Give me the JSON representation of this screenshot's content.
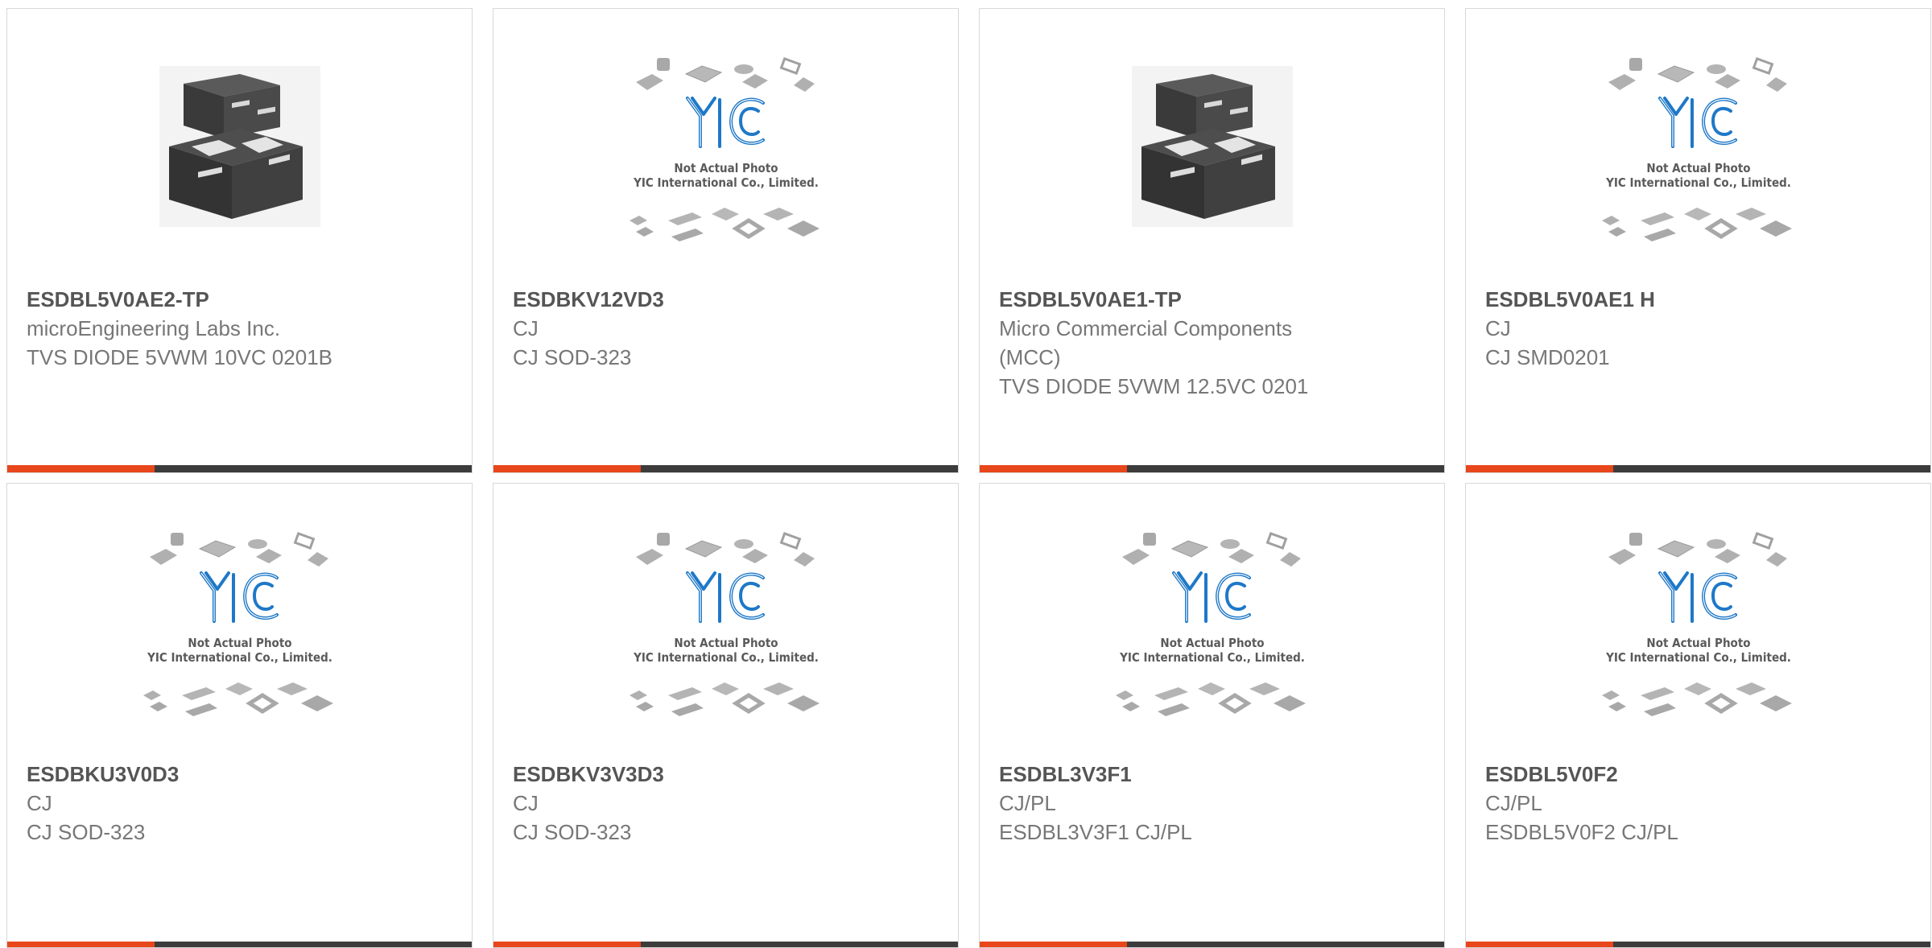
{
  "accent_color": "#e8461b",
  "bar_color": "#3c3c3c",
  "placeholder_caption": {
    "line1": "Not Actual Photo",
    "line2": "YIC International Co., Limited."
  },
  "products": [
    {
      "part": "ESDBL5V0AE2-TP",
      "manufacturer": "microEngineering Labs Inc.",
      "description": "TVS DIODE 5VWM 10VC 0201B",
      "image": "chip-photo"
    },
    {
      "part": "ESDBKV12VD3",
      "manufacturer": "CJ",
      "description": "CJ SOD-323",
      "image": "yic-placeholder"
    },
    {
      "part": "ESDBL5V0AE1-TP",
      "manufacturer": "Micro Commercial Components (MCC)",
      "description": "TVS DIODE 5VWM 12.5VC 0201",
      "image": "chip-photo"
    },
    {
      "part": "ESDBL5V0AE1 H",
      "manufacturer": "CJ",
      "description": "CJ SMD0201",
      "image": "yic-placeholder"
    },
    {
      "part": "ESDBKU3V0D3",
      "manufacturer": "CJ",
      "description": "CJ SOD-323",
      "image": "yic-placeholder"
    },
    {
      "part": "ESDBKV3V3D3",
      "manufacturer": "CJ",
      "description": "CJ SOD-323",
      "image": "yic-placeholder"
    },
    {
      "part": "ESDBL3V3F1",
      "manufacturer": "CJ/PL",
      "description": "ESDBL3V3F1 CJ/PL",
      "image": "yic-placeholder"
    },
    {
      "part": "ESDBL5V0F2",
      "manufacturer": "CJ/PL",
      "description": "ESDBL5V0F2 CJ/PL",
      "image": "yic-placeholder"
    }
  ]
}
